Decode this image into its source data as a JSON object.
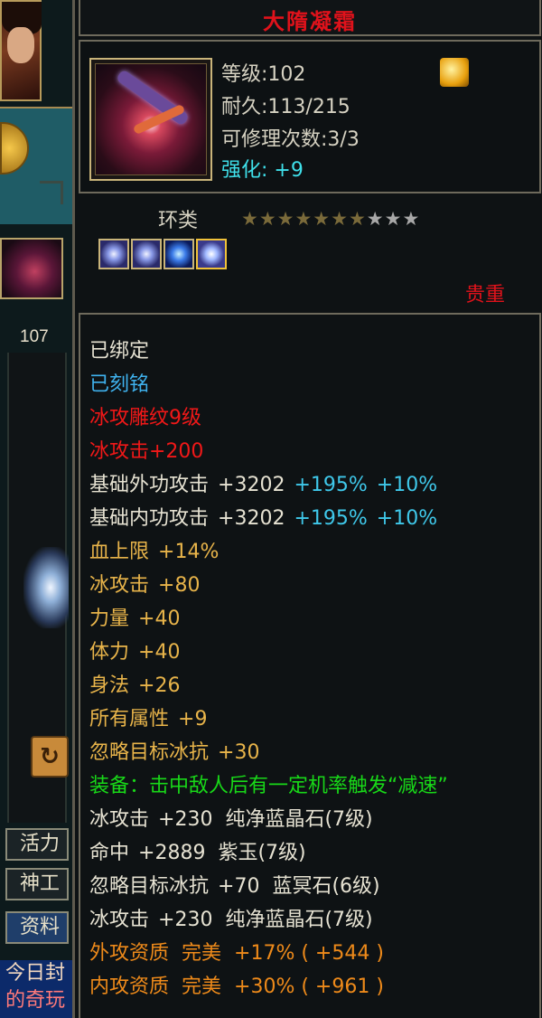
{
  "left_panel": {
    "level": "107",
    "tabs": [
      "活力",
      "神工",
      "资料"
    ],
    "chat_lines": [
      {
        "text": "今日封",
        "color": "#f2d8c0"
      },
      {
        "text": "的奇玩",
        "color": "#ff7a7a"
      }
    ]
  },
  "item": {
    "name": "大隋凝霜",
    "level_line": "等级:102",
    "durability_line": "耐久:113/215",
    "repair_line": "可修理次数:3/3",
    "enhance_line": "强化: +9",
    "category": "环类",
    "stars": {
      "filled": 7,
      "total": 10
    },
    "gem_slots": [
      "purple-gem",
      "purple-gem",
      "blue-gem",
      "gold-framed-gem"
    ],
    "rarity": "贵重"
  },
  "attributes": [
    {
      "name": "已绑定",
      "color": "white"
    },
    {
      "name": "已刻铭",
      "color": "blue"
    },
    {
      "name": "冰攻雕纹9级",
      "color": "red"
    },
    {
      "name": "冰攻击+200",
      "color": "red"
    },
    {
      "name": "基础外功攻击",
      "value": "+3202",
      "extra1": "+195%",
      "extra2": "+10%",
      "color": "white"
    },
    {
      "name": "基础内功攻击",
      "value": "+3202",
      "extra1": "+195%",
      "extra2": "+10%",
      "color": "white"
    },
    {
      "name": "血上限",
      "value": "+14%",
      "color": "gold"
    },
    {
      "name": "冰攻击",
      "value": "+80",
      "color": "gold"
    },
    {
      "name": "力量",
      "value": "+40",
      "color": "gold"
    },
    {
      "name": "体力",
      "value": "+40",
      "color": "gold"
    },
    {
      "name": "身法",
      "value": "+26",
      "color": "gold"
    },
    {
      "name": "所有属性",
      "value": "+9",
      "color": "gold"
    },
    {
      "name": "忽略目标冰抗",
      "value": "+30",
      "color": "gold"
    },
    {
      "name": "装备：击中敌人后有一定机率触发“减速”",
      "color": "green"
    },
    {
      "name": "冰攻击",
      "value": "+230",
      "extra_text": "纯净蓝晶石(7级)",
      "color": "white"
    },
    {
      "name": "命中",
      "value": "+2889",
      "extra_text": "紫玉(7级)",
      "color": "white"
    },
    {
      "name": "忽略目标冰抗",
      "value": "+70",
      "extra_text": "蓝冥石(6级)",
      "color": "white"
    },
    {
      "name": "冰攻击",
      "value": "+230",
      "extra_text": "纯净蓝晶石(7级)",
      "color": "white"
    },
    {
      "name": "外攻资质",
      "value": "完美",
      "extra_text": "+17% ( +544 )",
      "color": "orange"
    },
    {
      "name": "内攻资质",
      "value": "完美",
      "extra_text": "+30% ( +961 )",
      "color": "orange"
    }
  ]
}
